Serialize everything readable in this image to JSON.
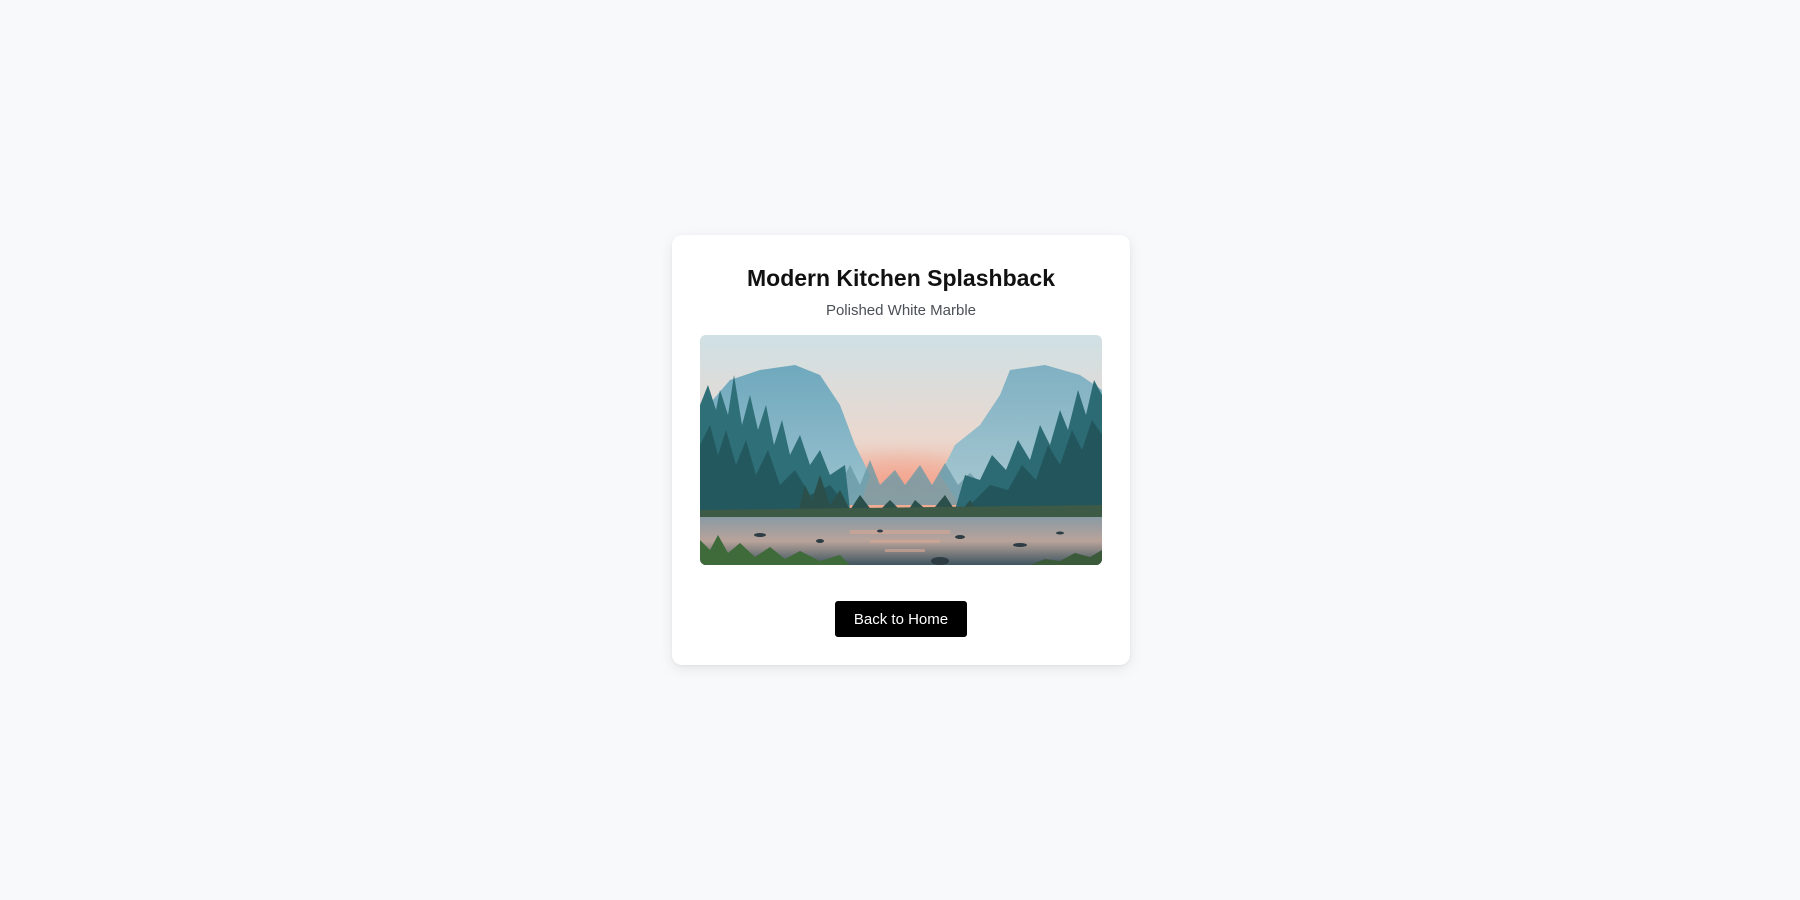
{
  "card": {
    "title": "Modern Kitchen Splashback",
    "subtitle": "Polished White Marble",
    "image": {
      "description_icon": "landscape-photo"
    },
    "back_button_label": "Back to Home"
  },
  "colors": {
    "background": "#f8f9fb",
    "card": "#ffffff",
    "button": "#000000",
    "button_text": "#ffffff",
    "title": "#111111",
    "subtitle": "#4b4f56"
  }
}
